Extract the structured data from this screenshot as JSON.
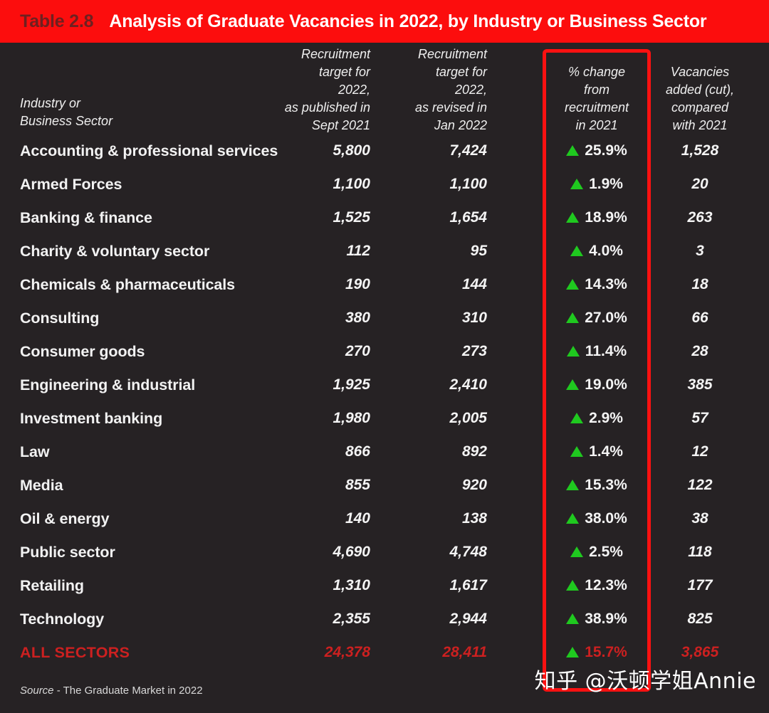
{
  "header": {
    "table_number": "Table 2.8",
    "title": "Analysis of Graduate Vacancies in 2022, by Industry or Business Sector",
    "bar_color": "#fc0d0d",
    "number_color": "#6e2020",
    "title_color": "#ffffff"
  },
  "highlight": {
    "color": "#fb1111",
    "target_column": "% change from recruitment in 2021"
  },
  "colors": {
    "background": "#262224",
    "text": "#f2f2f2",
    "triangle_up": "#1fc91f",
    "total_row": "#cc2020"
  },
  "columns": {
    "label": [
      "Industry or",
      "Business Sector"
    ],
    "c1": [
      "Recruitment",
      "target for 2022,",
      "as published in",
      "Sept 2021"
    ],
    "c2": [
      "Recruitment",
      "target for 2022,",
      "as revised in",
      "Jan 2022"
    ],
    "c3": [
      "% change",
      "from",
      "recruitment",
      "in 2021"
    ],
    "c4": [
      "Vacancies",
      "added (cut),",
      "compared",
      "with 2021"
    ]
  },
  "rows": [
    {
      "sector": "Accounting & professional services",
      "sept2021": "5,800",
      "jan2022": "7,424",
      "direction": "up",
      "pct_change": "25.9%",
      "vacancies_added": "1,528"
    },
    {
      "sector": "Armed Forces",
      "sept2021": "1,100",
      "jan2022": "1,100",
      "direction": "up",
      "pct_change": "1.9%",
      "vacancies_added": "20"
    },
    {
      "sector": "Banking & finance",
      "sept2021": "1,525",
      "jan2022": "1,654",
      "direction": "up",
      "pct_change": "18.9%",
      "vacancies_added": "263"
    },
    {
      "sector": "Charity & voluntary sector",
      "sept2021": "112",
      "jan2022": "95",
      "direction": "up",
      "pct_change": "4.0%",
      "vacancies_added": "3"
    },
    {
      "sector": "Chemicals & pharmaceuticals",
      "sept2021": "190",
      "jan2022": "144",
      "direction": "up",
      "pct_change": "14.3%",
      "vacancies_added": "18"
    },
    {
      "sector": "Consulting",
      "sept2021": "380",
      "jan2022": "310",
      "direction": "up",
      "pct_change": "27.0%",
      "vacancies_added": "66"
    },
    {
      "sector": "Consumer goods",
      "sept2021": "270",
      "jan2022": "273",
      "direction": "up",
      "pct_change": "11.4%",
      "vacancies_added": "28"
    },
    {
      "sector": "Engineering & industrial",
      "sept2021": "1,925",
      "jan2022": "2,410",
      "direction": "up",
      "pct_change": "19.0%",
      "vacancies_added": "385"
    },
    {
      "sector": "Investment banking",
      "sept2021": "1,980",
      "jan2022": "2,005",
      "direction": "up",
      "pct_change": "2.9%",
      "vacancies_added": "57"
    },
    {
      "sector": "Law",
      "sept2021": "866",
      "jan2022": "892",
      "direction": "up",
      "pct_change": "1.4%",
      "vacancies_added": "12"
    },
    {
      "sector": "Media",
      "sept2021": "855",
      "jan2022": "920",
      "direction": "up",
      "pct_change": "15.3%",
      "vacancies_added": "122"
    },
    {
      "sector": "Oil & energy",
      "sept2021": "140",
      "jan2022": "138",
      "direction": "up",
      "pct_change": "38.0%",
      "vacancies_added": "38"
    },
    {
      "sector": "Public sector",
      "sept2021": "4,690",
      "jan2022": "4,748",
      "direction": "up",
      "pct_change": "2.5%",
      "vacancies_added": "118"
    },
    {
      "sector": "Retailing",
      "sept2021": "1,310",
      "jan2022": "1,617",
      "direction": "up",
      "pct_change": "12.3%",
      "vacancies_added": "177"
    },
    {
      "sector": "Technology",
      "sept2021": "2,355",
      "jan2022": "2,944",
      "direction": "up",
      "pct_change": "38.9%",
      "vacancies_added": "825"
    }
  ],
  "total_row": {
    "sector": "ALL SECTORS",
    "sept2021": "24,378",
    "jan2022": "28,411",
    "direction": "up",
    "pct_change": "15.7%",
    "vacancies_added": "3,865"
  },
  "source": {
    "label": "Source",
    "text": " - The Graduate Market in 2022"
  },
  "watermark": {
    "text": "知乎 @沃顿学姐Annie"
  },
  "chart_data": {
    "type": "table",
    "title": "Analysis of Graduate Vacancies in 2022, by Industry or Business Sector",
    "columns": [
      "Industry or Business Sector",
      "Recruitment target for 2022, as published in Sept 2021",
      "Recruitment target for 2022, as revised in Jan 2022",
      "% change from recruitment in 2021",
      "Vacancies added (cut), compared with 2021"
    ],
    "rows": [
      [
        "Accounting & professional services",
        5800,
        7424,
        25.9,
        1528
      ],
      [
        "Armed Forces",
        1100,
        1100,
        1.9,
        20
      ],
      [
        "Banking & finance",
        1525,
        1654,
        18.9,
        263
      ],
      [
        "Charity & voluntary sector",
        112,
        95,
        4.0,
        3
      ],
      [
        "Chemicals & pharmaceuticals",
        190,
        144,
        14.3,
        18
      ],
      [
        "Consulting",
        380,
        310,
        27.0,
        66
      ],
      [
        "Consumer goods",
        270,
        273,
        11.4,
        28
      ],
      [
        "Engineering & industrial",
        1925,
        2410,
        19.0,
        385
      ],
      [
        "Investment banking",
        1980,
        2005,
        2.9,
        57
      ],
      [
        "Law",
        866,
        892,
        1.4,
        12
      ],
      [
        "Media",
        855,
        920,
        15.3,
        122
      ],
      [
        "Oil & energy",
        140,
        138,
        38.0,
        38
      ],
      [
        "Public sector",
        4690,
        4748,
        2.5,
        118
      ],
      [
        "Retailing",
        1310,
        1617,
        12.3,
        177
      ],
      [
        "Technology",
        2355,
        2944,
        38.9,
        825
      ],
      [
        "ALL SECTORS",
        24378,
        28411,
        15.7,
        3865
      ]
    ],
    "source": "Source - The Graduate Market in 2022"
  }
}
